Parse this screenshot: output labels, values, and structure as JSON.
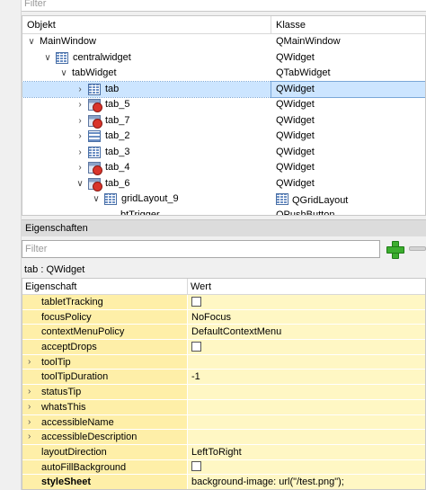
{
  "top_filter_placeholder": "Filter",
  "object_tree": {
    "columns": [
      "Objekt",
      "Klasse"
    ],
    "rows": [
      {
        "name": "MainWindow",
        "klass": "QMainWindow",
        "expander": "v",
        "icon": "",
        "indent": 0
      },
      {
        "name": "centralwidget",
        "klass": "QWidget",
        "expander": "v",
        "icon": "grid-layout-icon",
        "indent": 1
      },
      {
        "name": "tabWidget",
        "klass": "QTabWidget",
        "expander": "v",
        "icon": "",
        "indent": 2
      },
      {
        "name": "tab",
        "klass": "QWidget",
        "expander": ">",
        "icon": "grid-layout-icon",
        "indent": 3,
        "selected": true
      },
      {
        "name": "tab_5",
        "klass": "QWidget",
        "expander": ">",
        "icon": "broken-layout-icon",
        "indent": 3
      },
      {
        "name": "tab_7",
        "klass": "QWidget",
        "expander": ">",
        "icon": "broken-layout-icon",
        "indent": 3
      },
      {
        "name": "tab_2",
        "klass": "QWidget",
        "expander": ">",
        "icon": "vertical-layout-icon",
        "indent": 3
      },
      {
        "name": "tab_3",
        "klass": "QWidget",
        "expander": ">",
        "icon": "grid-layout-icon",
        "indent": 3
      },
      {
        "name": "tab_4",
        "klass": "QWidget",
        "expander": ">",
        "icon": "broken-layout-icon",
        "indent": 3
      },
      {
        "name": "tab_6",
        "klass": "QWidget",
        "expander": "v",
        "icon": "broken-layout-icon",
        "indent": 3
      },
      {
        "name": "gridLayout_9",
        "klass": "QGridLayout",
        "expander": "v",
        "icon": "grid-layout-icon",
        "indent": 4,
        "class_icon": "grid-layout-icon"
      },
      {
        "name": "btTrigger",
        "klass": "QPushButton",
        "expander": "",
        "icon": "",
        "indent": 5
      }
    ]
  },
  "property_panel": {
    "title": "Eigenschaften",
    "filter_placeholder": "Filter",
    "object_label": "tab : QWidget",
    "columns": [
      "Eigenschaft",
      "Wert"
    ],
    "rows": [
      {
        "name": "tabletTracking",
        "value": "",
        "checkbox": true,
        "expandable": false
      },
      {
        "name": "focusPolicy",
        "value": "NoFocus",
        "checkbox": false,
        "expandable": false
      },
      {
        "name": "contextMenuPolicy",
        "value": "DefaultContextMenu",
        "checkbox": false,
        "expandable": false
      },
      {
        "name": "acceptDrops",
        "value": "",
        "checkbox": true,
        "expandable": false
      },
      {
        "name": "toolTip",
        "value": "",
        "checkbox": false,
        "expandable": true
      },
      {
        "name": "toolTipDuration",
        "value": "-1",
        "checkbox": false,
        "expandable": false
      },
      {
        "name": "statusTip",
        "value": "",
        "checkbox": false,
        "expandable": true
      },
      {
        "name": "whatsThis",
        "value": "",
        "checkbox": false,
        "expandable": true
      },
      {
        "name": "accessibleName",
        "value": "",
        "checkbox": false,
        "expandable": true
      },
      {
        "name": "accessibleDescription",
        "value": "",
        "checkbox": false,
        "expandable": true
      },
      {
        "name": "layoutDirection",
        "value": "LeftToRight",
        "checkbox": false,
        "expandable": false
      },
      {
        "name": "autoFillBackground",
        "value": "",
        "checkbox": true,
        "expandable": false
      },
      {
        "name": "styleSheet",
        "value": "background-image: url(\"/test.png\");",
        "checkbox": false,
        "expandable": false,
        "bold": true
      }
    ]
  },
  "colors": {
    "selection": "#cce5ff",
    "property_name_bg": "#feefa8",
    "property_value_bg": "#fff7c4",
    "add_icon": "#3cae2e"
  }
}
